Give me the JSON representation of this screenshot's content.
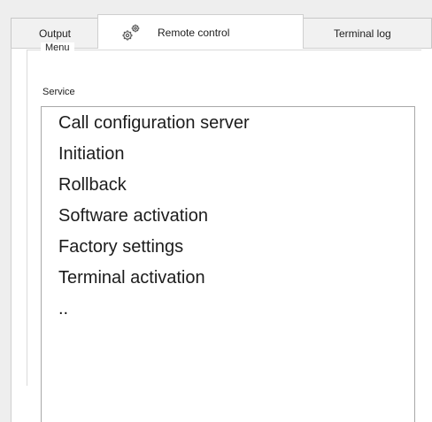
{
  "tabs": [
    {
      "label": "Output",
      "selected": false
    },
    {
      "label": "Remote control",
      "icon": "gears-icon",
      "selected": true
    },
    {
      "label": "Terminal log",
      "selected": false
    }
  ],
  "menu_group": {
    "title": "Menu",
    "service_label": "Service",
    "service_items": [
      "Call configuration server",
      "Initiation",
      "Rollback",
      "Software activation",
      "Factory settings",
      "Terminal activation",
      ".."
    ]
  },
  "colors": {
    "background": "#eeeeee",
    "panel": "#ffffff",
    "text": "#1e1e1e",
    "border": "#a8a8a8"
  }
}
